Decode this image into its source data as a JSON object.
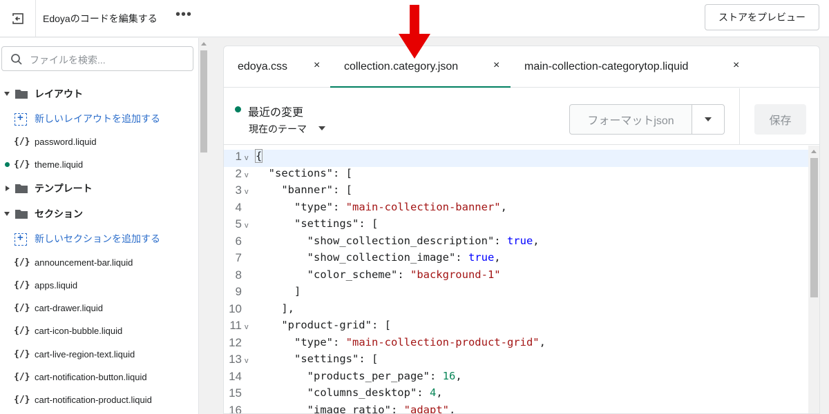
{
  "topbar": {
    "title": "Edoyaのコードを編集する",
    "more": "•••",
    "preview_label": "ストアをプレビュー"
  },
  "sidebar": {
    "search_placeholder": "ファイルを検索...",
    "folders": [
      {
        "label": "レイアウト",
        "expanded": true
      },
      {
        "label": "テンプレート",
        "expanded": false
      },
      {
        "label": "セクション",
        "expanded": true
      }
    ],
    "layout_items": {
      "add_label": "新しいレイアウトを追加する",
      "files": [
        "password.liquid",
        "theme.liquid"
      ]
    },
    "section_items": {
      "add_label": "新しいセクションを追加する",
      "files": [
        "announcement-bar.liquid",
        "apps.liquid",
        "cart-drawer.liquid",
        "cart-icon-bubble.liquid",
        "cart-live-region-text.liquid",
        "cart-notification-button.liquid",
        "cart-notification-product.liquid"
      ]
    },
    "file_icon": "{/}"
  },
  "tabs": [
    {
      "label": "edoya.css",
      "close": "×",
      "active": false
    },
    {
      "label": "collection.category.json",
      "close": "×",
      "active": true
    },
    {
      "label": "main-collection-categorytop.liquid",
      "close": "×",
      "active": false
    }
  ],
  "toolbar": {
    "status": "最近の変更",
    "theme_select": "現在のテーマ",
    "format_label": "フォーマットjson",
    "save_label": "保存"
  },
  "code": {
    "lines": [
      {
        "n": "1",
        "fold": true,
        "text": "{"
      },
      {
        "n": "2",
        "fold": true,
        "text": "  \"sections\": ["
      },
      {
        "n": "3",
        "fold": true,
        "text": "    \"banner\": ["
      },
      {
        "n": "4",
        "fold": false,
        "text": "      \"type\": \"main-collection-banner\","
      },
      {
        "n": "5",
        "fold": true,
        "text": "      \"settings\": ["
      },
      {
        "n": "6",
        "fold": false,
        "text": "        \"show_collection_description\": true,"
      },
      {
        "n": "7",
        "fold": false,
        "text": "        \"show_collection_image\": true,"
      },
      {
        "n": "8",
        "fold": false,
        "text": "        \"color_scheme\": \"background-1\""
      },
      {
        "n": "9",
        "fold": false,
        "text": "      ]"
      },
      {
        "n": "10",
        "fold": false,
        "text": "    ],"
      },
      {
        "n": "11",
        "fold": true,
        "text": "    \"product-grid\": ["
      },
      {
        "n": "12",
        "fold": false,
        "text": "      \"type\": \"main-collection-product-grid\","
      },
      {
        "n": "13",
        "fold": true,
        "text": "      \"settings\": ["
      },
      {
        "n": "14",
        "fold": false,
        "text": "        \"products_per_page\": 16,"
      },
      {
        "n": "15",
        "fold": false,
        "text": "        \"columns_desktop\": 4,"
      },
      {
        "n": "16",
        "fold": false,
        "text": "        \"image_ratio\": \"adapt\","
      }
    ]
  },
  "colors": {
    "accent": "#008060",
    "link": "#2c6ecb",
    "annotation_arrow": "#e60000",
    "string": "#a31515",
    "boolean": "#0000ff",
    "number": "#098658"
  }
}
